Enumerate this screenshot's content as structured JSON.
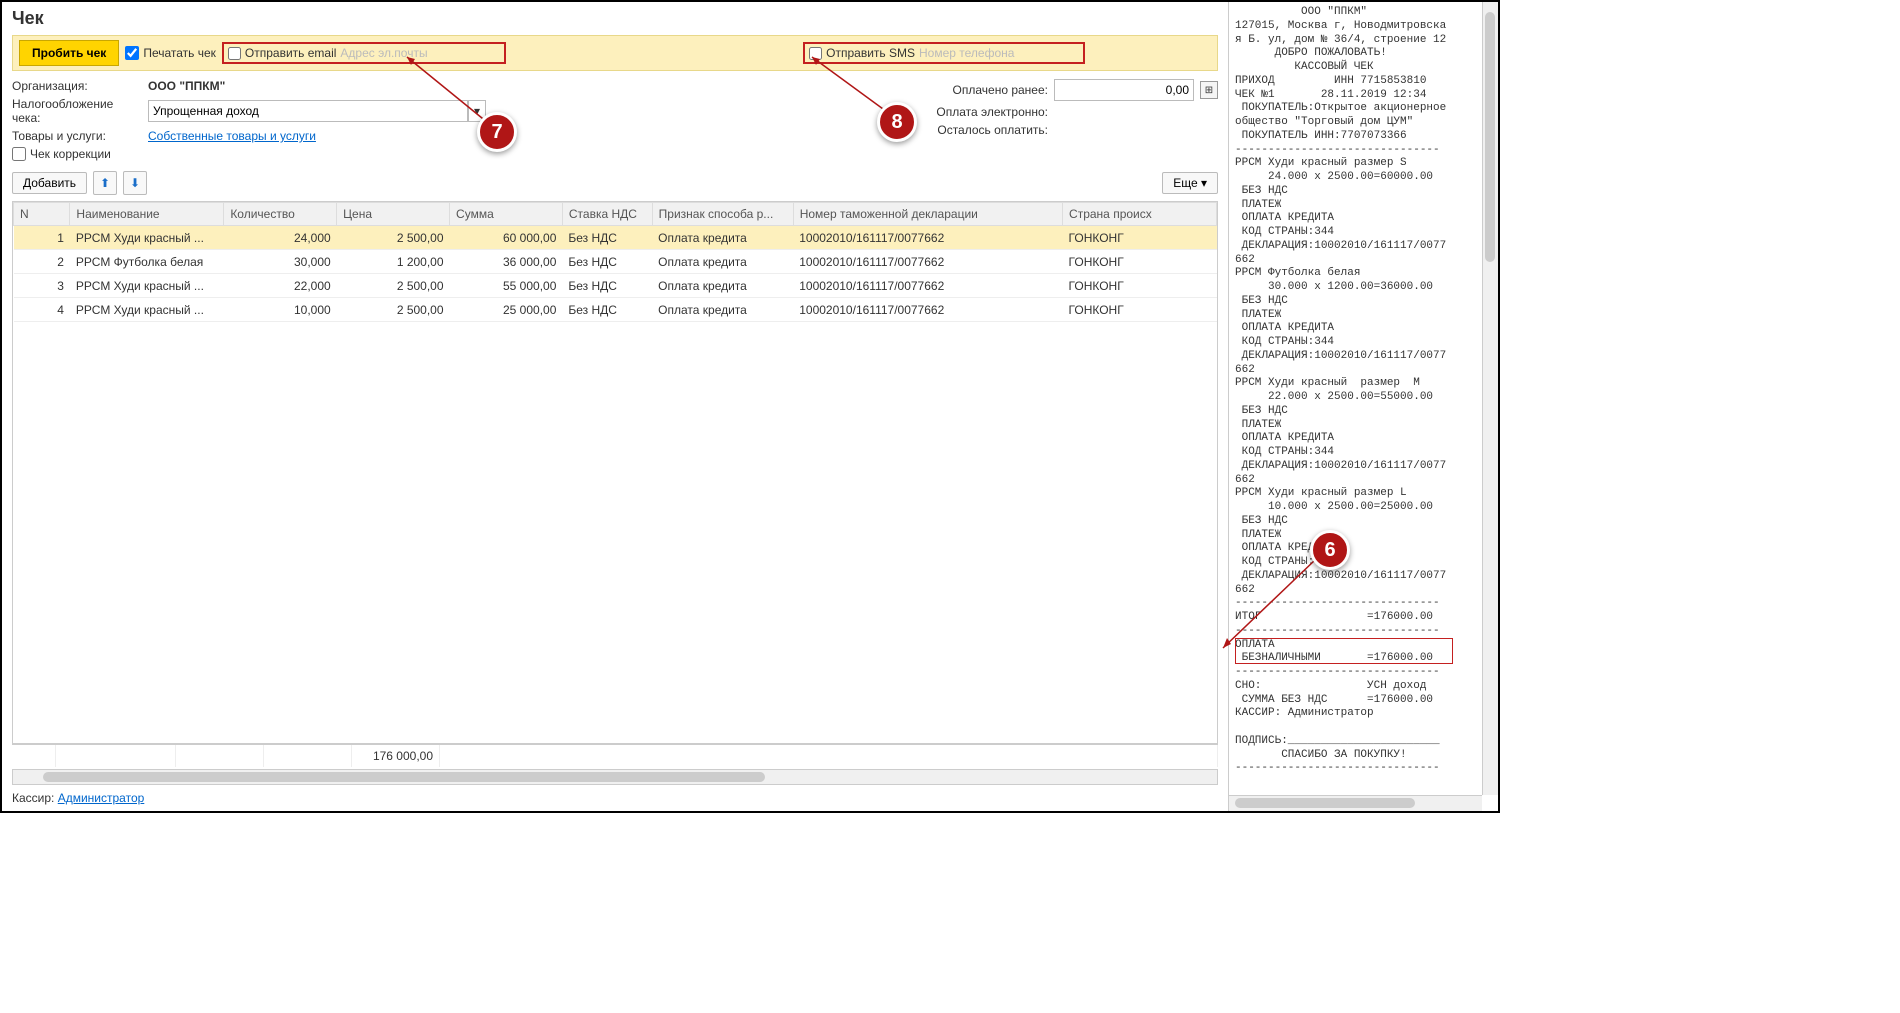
{
  "title": "Чек",
  "toolbar": {
    "punch": "Пробить чек",
    "print_label": "Печатать чек",
    "send_email_label": "Отправить email",
    "email_placeholder": "Адрес эл.почты",
    "send_sms_label": "Отправить SMS",
    "sms_placeholder": "Номер телефона"
  },
  "form": {
    "org_label": "Организация:",
    "org_value": "ООО \"ППКМ\"",
    "tax_label": "Налогообложение чека:",
    "tax_value": "Упрощенная доход",
    "goods_label": "Товары и услуги:",
    "goods_link": "Собственные товары и услуги",
    "correction_label": "Чек коррекции",
    "paid_before_label": "Оплачено ранее:",
    "paid_before_value": "0,00",
    "paid_elec_label": "Оплата электронно:",
    "remain_label": "Осталось оплатить:"
  },
  "subbar": {
    "add": "Добавить",
    "more": "Еще"
  },
  "columns": [
    "N",
    "Наименование",
    "Количество",
    "Цена",
    "Сумма",
    "Ставка НДС",
    "Признак способа р...",
    "Номер таможенной декларации",
    "Страна происх"
  ],
  "rows": [
    {
      "n": "1",
      "name": "РРСМ Худи красный ...",
      "qty": "24,000",
      "price": "2 500,00",
      "sum": "60 000,00",
      "vat": "Без НДС",
      "sign": "Оплата кредита",
      "decl": "10002010/161117/0077662",
      "country": "ГОНКОНГ"
    },
    {
      "n": "2",
      "name": "РРСМ Футболка белая",
      "qty": "30,000",
      "price": "1 200,00",
      "sum": "36 000,00",
      "vat": "Без НДС",
      "sign": "Оплата кредита",
      "decl": "10002010/161117/0077662",
      "country": "ГОНКОНГ"
    },
    {
      "n": "3",
      "name": "РРСМ Худи красный ...",
      "qty": "22,000",
      "price": "2 500,00",
      "sum": "55 000,00",
      "vat": "Без НДС",
      "sign": "Оплата кредита",
      "decl": "10002010/161117/0077662",
      "country": "ГОНКОНГ"
    },
    {
      "n": "4",
      "name": "РРСМ Худи красный ...",
      "qty": "10,000",
      "price": "2 500,00",
      "sum": "25 000,00",
      "vat": "Без НДС",
      "sign": "Оплата кредита",
      "decl": "10002010/161117/0077662",
      "country": "ГОНКОНГ"
    }
  ],
  "footer_total": "176 000,00",
  "cashier_label": "Кассир:",
  "cashier_value": "Администратор",
  "callouts": {
    "c6": "6",
    "c7": "7",
    "c8": "8"
  },
  "receipt_text": "          ООО \"ППКМ\"\n127015, Москва г, Новодмитровска\nя Б. ул, дом № 36/4, строение 12\n      ДОБРО ПОЖАЛОВАТЬ!\n         КАССОВЫЙ ЧЕК\nПРИХОД         ИНН 7715853810\nЧЕК №1       28.11.2019 12:34\n ПОКУПАТЕЛЬ:Открытое акционерное\nобщество \"Торговый дом ЦУМ\"\n ПОКУПАТЕЛЬ ИНН:7707073366\n-------------------------------\nРРСМ Худи красный размер S\n     24.000 x 2500.00=60000.00\n БЕЗ НДС\n ПЛАТЕЖ\n ОПЛАТА КРЕДИТА\n КОД СТРАНЫ:344\n ДЕКЛАРАЦИЯ:10002010/161117/0077\n662\nРРСМ Футболка белая\n     30.000 x 1200.00=36000.00\n БЕЗ НДС\n ПЛАТЕЖ\n ОПЛАТА КРЕДИТА\n КОД СТРАНЫ:344\n ДЕКЛАРАЦИЯ:10002010/161117/0077\n662\nРРСМ Худи красный  размер  M\n     22.000 x 2500.00=55000.00\n БЕЗ НДС\n ПЛАТЕЖ\n ОПЛАТА КРЕДИТА\n КОД СТРАНЫ:344\n ДЕКЛАРАЦИЯ:10002010/161117/0077\n662\nРРСМ Худи красный размер L\n     10.000 x 2500.00=25000.00\n БЕЗ НДС\n ПЛАТЕЖ\n ОПЛАТА КРЕДИТА\n КОД СТРАНЫ:344\n ДЕКЛАРАЦИЯ:10002010/161117/0077\n662\n-------------------------------\nИТОГ                =176000.00\n-------------------------------\nОПЛАТА\n БЕЗНАЛИЧНЫМИ       =176000.00\n-------------------------------\nСНО:                УСН доход\n СУММА БЕЗ НДС      =176000.00\nКАССИР: Администратор\n\nПОДПИСЬ:_______________________\n       СПАСИБО ЗА ПОКУПКУ!\n-------------------------------"
}
